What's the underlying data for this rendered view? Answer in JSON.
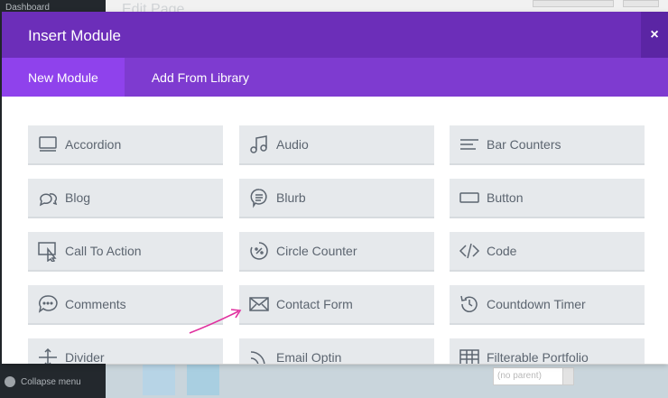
{
  "background": {
    "sidebar_top": "Dashboard",
    "page_title": "Edit Page",
    "collapse_menu": "Collapse menu",
    "parent_select": "(no parent)"
  },
  "modal": {
    "title": "Insert Module",
    "close": "×",
    "tabs": [
      {
        "label": "New Module",
        "active": true
      },
      {
        "label": "Add From Library",
        "active": false
      }
    ],
    "modules": [
      {
        "label": "Accordion",
        "icon": "accordion-icon"
      },
      {
        "label": "Audio",
        "icon": "audio-icon"
      },
      {
        "label": "Bar Counters",
        "icon": "bar-counters-icon"
      },
      {
        "label": "Blog",
        "icon": "blog-icon"
      },
      {
        "label": "Blurb",
        "icon": "blurb-icon"
      },
      {
        "label": "Button",
        "icon": "button-icon"
      },
      {
        "label": "Call To Action",
        "icon": "call-to-action-icon"
      },
      {
        "label": "Circle Counter",
        "icon": "circle-counter-icon"
      },
      {
        "label": "Code",
        "icon": "code-icon"
      },
      {
        "label": "Comments",
        "icon": "comments-icon"
      },
      {
        "label": "Contact Form",
        "icon": "contact-form-icon"
      },
      {
        "label": "Countdown Timer",
        "icon": "countdown-timer-icon"
      },
      {
        "label": "Divider",
        "icon": "divider-icon"
      },
      {
        "label": "Email Optin",
        "icon": "email-optin-icon"
      },
      {
        "label": "Filterable Portfolio",
        "icon": "filterable-portfolio-icon"
      }
    ]
  },
  "colors": {
    "header": "#6c2eb9",
    "tab_bar": "#7e3bd0",
    "active_tab": "#8f42ec",
    "tile_bg": "#e6e9ec",
    "annotation_arrow": "#e0309e"
  }
}
